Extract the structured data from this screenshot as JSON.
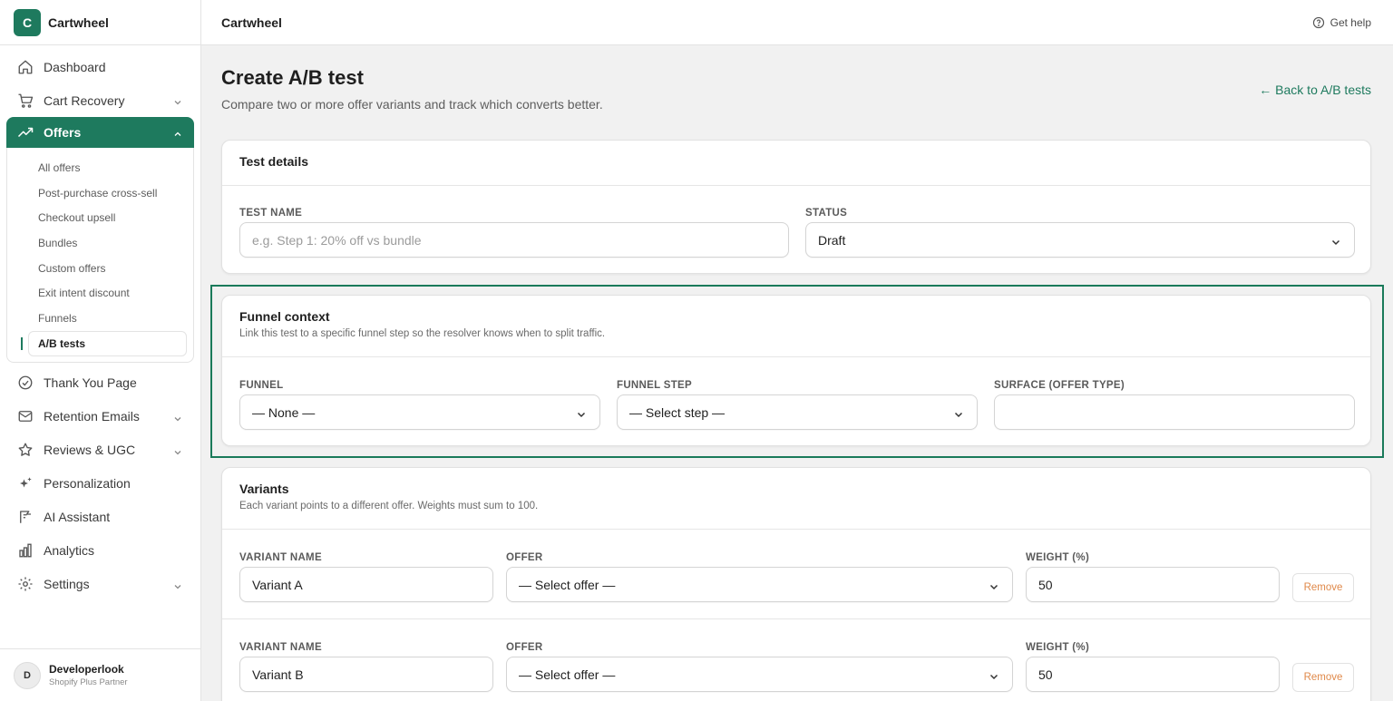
{
  "app": {
    "logo_letter": "C",
    "name": "Cartwheel"
  },
  "sidebar": {
    "items": [
      {
        "label": "Dashboard"
      },
      {
        "label": "Cart Recovery"
      },
      {
        "label": "Offers"
      },
      {
        "label": "Thank You Page"
      },
      {
        "label": "Retention Emails"
      },
      {
        "label": "Reviews & UGC"
      },
      {
        "label": "Personalization"
      },
      {
        "label": "AI Assistant"
      },
      {
        "label": "Analytics"
      },
      {
        "label": "Settings"
      }
    ],
    "offers_sub": [
      {
        "label": "All offers"
      },
      {
        "label": "Post-purchase cross-sell"
      },
      {
        "label": "Checkout upsell"
      },
      {
        "label": "Bundles"
      },
      {
        "label": "Custom offers"
      },
      {
        "label": "Exit intent discount"
      },
      {
        "label": "Funnels"
      },
      {
        "label": "A/B tests"
      }
    ],
    "user": {
      "initial": "D",
      "name": "Developerlook",
      "role": "Shopify Plus Partner"
    }
  },
  "topbar": {
    "title": "Cartwheel",
    "help_label": "Get help"
  },
  "page": {
    "title": "Create A/B test",
    "subtitle": "Compare two or more offer variants and track which converts better.",
    "back_label": "← Back to A/B tests"
  },
  "test_details": {
    "title": "Test details",
    "name_label": "TEST NAME",
    "name_placeholder": "e.g. Step 1: 20% off vs bundle",
    "status_label": "STATUS",
    "status_value": "Draft"
  },
  "funnel_context": {
    "title": "Funnel context",
    "description": "Link this test to a specific funnel step so the resolver knows when to split traffic.",
    "funnel_label": "FUNNEL",
    "funnel_value": "— None —",
    "step_label": "FUNNEL STEP",
    "step_value": "— Select step —",
    "surface_label": "SURFACE (OFFER TYPE)",
    "surface_value": ""
  },
  "variants": {
    "title": "Variants",
    "description": "Each variant points to a different offer. Weights must sum to 100.",
    "name_label": "VARIANT NAME",
    "offer_label": "OFFER",
    "weight_label": "WEIGHT (%)",
    "remove_label": "Remove",
    "rows": [
      {
        "name": "Variant A",
        "offer": "— Select offer —",
        "weight": "50"
      },
      {
        "name": "Variant B",
        "offer": "— Select offer —",
        "weight": "50"
      }
    ]
  },
  "colors": {
    "accent": "#1e7a5e",
    "remove": "#e0894a",
    "highlight": "#1a7a5a"
  }
}
